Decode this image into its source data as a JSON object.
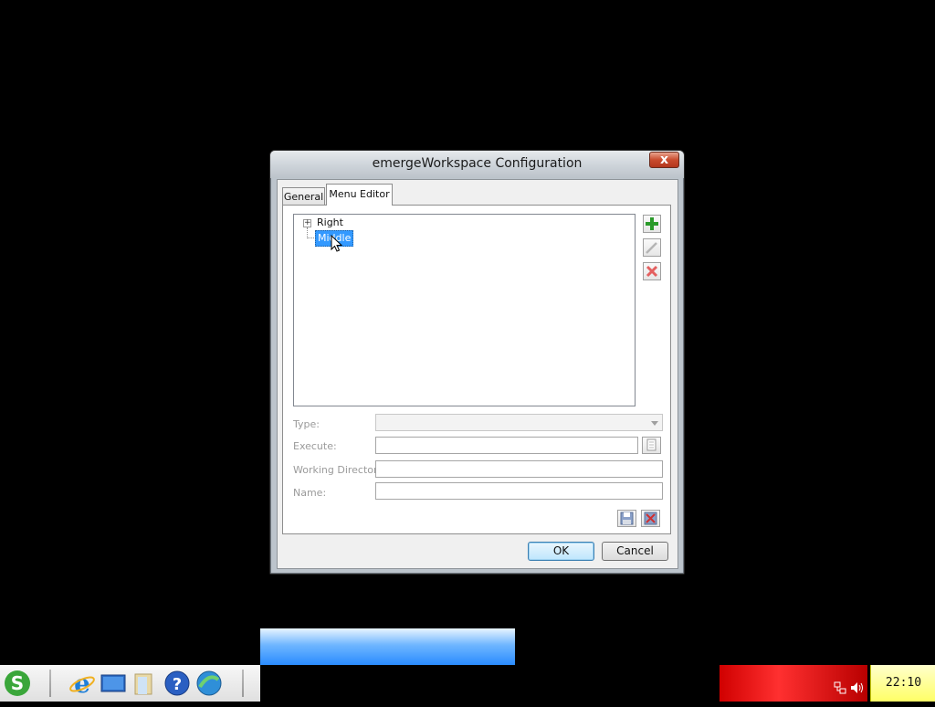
{
  "dialog": {
    "title": "emergeWorkspace Configuration",
    "close_glyph": "x",
    "tabs": [
      {
        "label": "General",
        "selected": false
      },
      {
        "label": "Menu Editor",
        "selected": true
      }
    ],
    "tree": {
      "items": [
        {
          "label": "Right",
          "expander": "+",
          "selected": false
        },
        {
          "label": "Middle",
          "selected": true
        }
      ]
    },
    "side_buttons": [
      {
        "icon": "add-plus-icon",
        "glyph": "+",
        "color": "#2a9a2a"
      },
      {
        "icon": "edit-pencil-icon",
        "glyph": "/",
        "color": "#b0b0b0"
      },
      {
        "icon": "delete-x-icon",
        "glyph": "x",
        "color": "#e05050"
      }
    ],
    "form": {
      "type_label": "Type:",
      "type_value": "",
      "execute_label": "Execute:",
      "execute_value": "",
      "workdir_label": "Working Directory:",
      "workdir_value": "",
      "name_label": "Name:",
      "name_value": ""
    },
    "ok_label": "OK",
    "cancel_label": "Cancel"
  },
  "taskbar": {
    "icons": [
      "emerge-s-icon",
      "ie-browser-icon",
      "desktop-icon",
      "folder-icon",
      "help-icon",
      "globe-icon"
    ],
    "clock": "22:10"
  }
}
